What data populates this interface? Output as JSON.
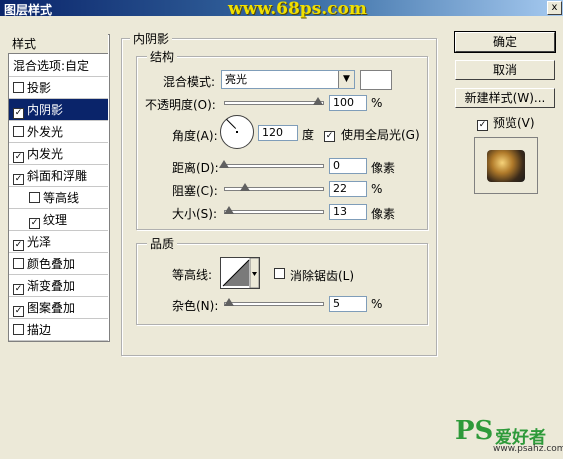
{
  "window": {
    "title": "图层样式",
    "close": "x"
  },
  "watermark": "www.68ps.com",
  "sidebar": {
    "header": "样式",
    "items": [
      {
        "label": "混合选项:自定",
        "checked": null,
        "selected": false
      },
      {
        "label": "投影",
        "checked": false,
        "selected": false
      },
      {
        "label": "内阴影",
        "checked": true,
        "selected": true
      },
      {
        "label": "外发光",
        "checked": false,
        "selected": false
      },
      {
        "label": "内发光",
        "checked": true,
        "selected": false
      },
      {
        "label": "斜面和浮雕",
        "checked": true,
        "selected": false
      },
      {
        "label": "等高线",
        "checked": false,
        "selected": false
      },
      {
        "label": "纹理",
        "checked": true,
        "selected": false
      },
      {
        "label": "光泽",
        "checked": true,
        "selected": false
      },
      {
        "label": "颜色叠加",
        "checked": false,
        "selected": false
      },
      {
        "label": "渐变叠加",
        "checked": true,
        "selected": false
      },
      {
        "label": "图案叠加",
        "checked": true,
        "selected": false
      },
      {
        "label": "描边",
        "checked": false,
        "selected": false
      }
    ]
  },
  "panel": {
    "title": "内阴影",
    "structure": {
      "title": "结构",
      "blend_label": "混合模式:",
      "blend_value": "亮光",
      "opacity_label": "不透明度(O):",
      "opacity_value": "100",
      "opacity_unit": "%",
      "opacity_level": 1.0,
      "angle_label": "角度(A):",
      "angle_value": "120",
      "angle_unit": "度",
      "global_light_label": "使用全局光(G)",
      "global_light_checked": true,
      "distance_label": "距离(D):",
      "distance_value": "0",
      "distance_unit": "像素",
      "distance_level": 0.0,
      "choke_label": "阻塞(C):",
      "choke_value": "22",
      "choke_unit": "%",
      "choke_level": 0.22,
      "size_label": "大小(S):",
      "size_value": "13",
      "size_unit": "像素",
      "size_level": 0.05
    },
    "quality": {
      "title": "品质",
      "contour_label": "等高线:",
      "antialias_label": "消除锯齿(L)",
      "antialias_checked": false,
      "noise_label": "杂色(N):",
      "noise_value": "5",
      "noise_unit": "%",
      "noise_level": 0.05
    }
  },
  "buttons": {
    "ok": "确定",
    "cancel": "取消",
    "new_style": "新建样式(W)...",
    "preview_label": "预览(V)",
    "preview_checked": true
  },
  "footer_logo": {
    "ps": "PS",
    "text": "爱好者",
    "url": "www.psahz.com"
  },
  "colors": {
    "selection": "#0a246a",
    "title_start": "#0a246a",
    "watermark": "#f0e000",
    "logo_green": "#2e9a3a"
  }
}
